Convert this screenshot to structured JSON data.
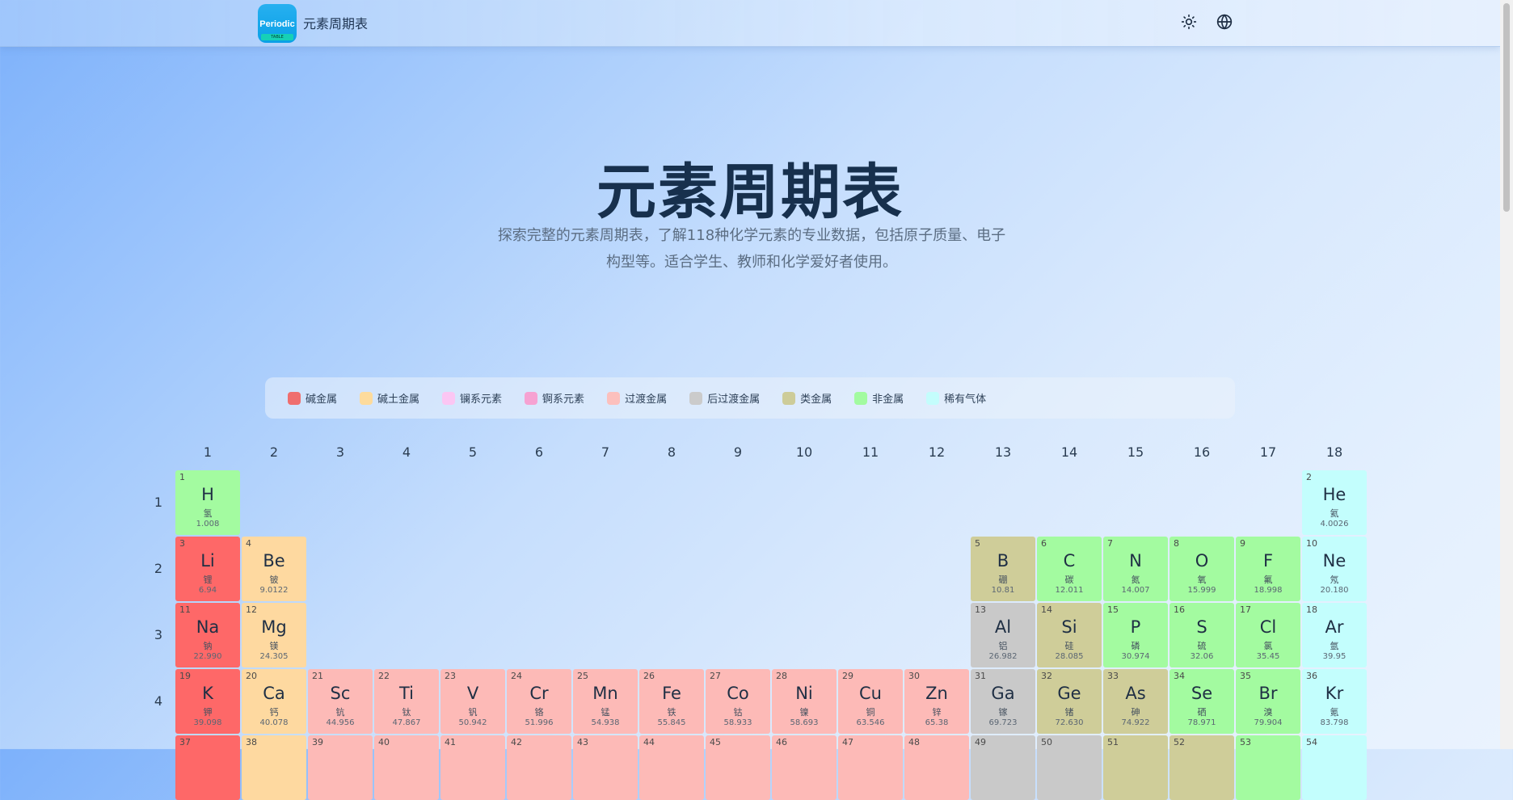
{
  "header": {
    "logo_text": "Periodic",
    "logo_sub": "TABLE",
    "title": "元素周期表",
    "icons": [
      "sun-icon",
      "globe-icon"
    ]
  },
  "hero": {
    "title": "元素周期表",
    "subtitle_line1": "探索完整的元素周期表，了解118种化学元素的专业数据，包括原子质量、电子",
    "subtitle_line2": "构型等。适合学生、教师和化学爱好者使用。"
  },
  "legend": [
    {
      "label": "碱金属",
      "color": "#ef6e6e"
    },
    {
      "label": "碱土金属",
      "color": "#fddb9c"
    },
    {
      "label": "镧系元素",
      "color": "#fbc6f3"
    },
    {
      "label": "锕系元素",
      "color": "#f6a2d2"
    },
    {
      "label": "过渡金属",
      "color": "#fcc0bd"
    },
    {
      "label": "后过渡金属",
      "color": "#cbcbcb"
    },
    {
      "label": "类金属",
      "color": "#cdcc99"
    },
    {
      "label": "非金属",
      "color": "#a2fba0"
    },
    {
      "label": "稀有气体",
      "color": "#c4fdfc"
    }
  ],
  "category_colors": {
    "alkali": "#fe6868",
    "alkaline": "#fed9a0",
    "transition": "#fdbab7",
    "post": "#c9c9c9",
    "metalloid": "#cfcd99",
    "nonmetal": "#a3fba0",
    "noble": "#c3fefd"
  },
  "groups": [
    "1",
    "2",
    "3",
    "4",
    "5",
    "6",
    "7",
    "8",
    "9",
    "10",
    "11",
    "12",
    "13",
    "14",
    "15",
    "16",
    "17",
    "18"
  ],
  "periods": [
    "1",
    "2",
    "3",
    "4"
  ],
  "elements": [
    {
      "n": "1",
      "s": "H",
      "cn": "氢",
      "m": "1.008",
      "g": 1,
      "p": 1,
      "c": "nonmetal"
    },
    {
      "n": "2",
      "s": "He",
      "cn": "氦",
      "m": "4.0026",
      "g": 18,
      "p": 1,
      "c": "noble"
    },
    {
      "n": "3",
      "s": "Li",
      "cn": "锂",
      "m": "6.94",
      "g": 1,
      "p": 2,
      "c": "alkali"
    },
    {
      "n": "4",
      "s": "Be",
      "cn": "铍",
      "m": "9.0122",
      "g": 2,
      "p": 2,
      "c": "alkaline"
    },
    {
      "n": "5",
      "s": "B",
      "cn": "硼",
      "m": "10.81",
      "g": 13,
      "p": 2,
      "c": "metalloid"
    },
    {
      "n": "6",
      "s": "C",
      "cn": "碳",
      "m": "12.011",
      "g": 14,
      "p": 2,
      "c": "nonmetal"
    },
    {
      "n": "7",
      "s": "N",
      "cn": "氮",
      "m": "14.007",
      "g": 15,
      "p": 2,
      "c": "nonmetal"
    },
    {
      "n": "8",
      "s": "O",
      "cn": "氧",
      "m": "15.999",
      "g": 16,
      "p": 2,
      "c": "nonmetal"
    },
    {
      "n": "9",
      "s": "F",
      "cn": "氟",
      "m": "18.998",
      "g": 17,
      "p": 2,
      "c": "nonmetal"
    },
    {
      "n": "10",
      "s": "Ne",
      "cn": "氖",
      "m": "20.180",
      "g": 18,
      "p": 2,
      "c": "noble"
    },
    {
      "n": "11",
      "s": "Na",
      "cn": "钠",
      "m": "22.990",
      "g": 1,
      "p": 3,
      "c": "alkali"
    },
    {
      "n": "12",
      "s": "Mg",
      "cn": "镁",
      "m": "24.305",
      "g": 2,
      "p": 3,
      "c": "alkaline"
    },
    {
      "n": "13",
      "s": "Al",
      "cn": "铝",
      "m": "26.982",
      "g": 13,
      "p": 3,
      "c": "post"
    },
    {
      "n": "14",
      "s": "Si",
      "cn": "硅",
      "m": "28.085",
      "g": 14,
      "p": 3,
      "c": "metalloid"
    },
    {
      "n": "15",
      "s": "P",
      "cn": "磷",
      "m": "30.974",
      "g": 15,
      "p": 3,
      "c": "nonmetal"
    },
    {
      "n": "16",
      "s": "S",
      "cn": "硫",
      "m": "32.06",
      "g": 16,
      "p": 3,
      "c": "nonmetal"
    },
    {
      "n": "17",
      "s": "Cl",
      "cn": "氯",
      "m": "35.45",
      "g": 17,
      "p": 3,
      "c": "nonmetal"
    },
    {
      "n": "18",
      "s": "Ar",
      "cn": "氩",
      "m": "39.95",
      "g": 18,
      "p": 3,
      "c": "noble"
    },
    {
      "n": "19",
      "s": "K",
      "cn": "钾",
      "m": "39.098",
      "g": 1,
      "p": 4,
      "c": "alkali"
    },
    {
      "n": "20",
      "s": "Ca",
      "cn": "钙",
      "m": "40.078",
      "g": 2,
      "p": 4,
      "c": "alkaline"
    },
    {
      "n": "21",
      "s": "Sc",
      "cn": "钪",
      "m": "44.956",
      "g": 3,
      "p": 4,
      "c": "transition"
    },
    {
      "n": "22",
      "s": "Ti",
      "cn": "钛",
      "m": "47.867",
      "g": 4,
      "p": 4,
      "c": "transition"
    },
    {
      "n": "23",
      "s": "V",
      "cn": "钒",
      "m": "50.942",
      "g": 5,
      "p": 4,
      "c": "transition"
    },
    {
      "n": "24",
      "s": "Cr",
      "cn": "铬",
      "m": "51.996",
      "g": 6,
      "p": 4,
      "c": "transition"
    },
    {
      "n": "25",
      "s": "Mn",
      "cn": "锰",
      "m": "54.938",
      "g": 7,
      "p": 4,
      "c": "transition"
    },
    {
      "n": "26",
      "s": "Fe",
      "cn": "铁",
      "m": "55.845",
      "g": 8,
      "p": 4,
      "c": "transition"
    },
    {
      "n": "27",
      "s": "Co",
      "cn": "钴",
      "m": "58.933",
      "g": 9,
      "p": 4,
      "c": "transition"
    },
    {
      "n": "28",
      "s": "Ni",
      "cn": "镍",
      "m": "58.693",
      "g": 10,
      "p": 4,
      "c": "transition"
    },
    {
      "n": "29",
      "s": "Cu",
      "cn": "铜",
      "m": "63.546",
      "g": 11,
      "p": 4,
      "c": "transition"
    },
    {
      "n": "30",
      "s": "Zn",
      "cn": "锌",
      "m": "65.38",
      "g": 12,
      "p": 4,
      "c": "transition"
    },
    {
      "n": "31",
      "s": "Ga",
      "cn": "镓",
      "m": "69.723",
      "g": 13,
      "p": 4,
      "c": "post"
    },
    {
      "n": "32",
      "s": "Ge",
      "cn": "锗",
      "m": "72.630",
      "g": 14,
      "p": 4,
      "c": "metalloid"
    },
    {
      "n": "33",
      "s": "As",
      "cn": "砷",
      "m": "74.922",
      "g": 15,
      "p": 4,
      "c": "metalloid"
    },
    {
      "n": "34",
      "s": "Se",
      "cn": "硒",
      "m": "78.971",
      "g": 16,
      "p": 4,
      "c": "nonmetal"
    },
    {
      "n": "35",
      "s": "Br",
      "cn": "溴",
      "m": "79.904",
      "g": 17,
      "p": 4,
      "c": "nonmetal"
    },
    {
      "n": "36",
      "s": "Kr",
      "cn": "氪",
      "m": "83.798",
      "g": 18,
      "p": 4,
      "c": "noble"
    },
    {
      "n": "37",
      "s": "",
      "cn": "",
      "m": "",
      "g": 1,
      "p": 5,
      "c": "alkali"
    },
    {
      "n": "38",
      "s": "",
      "cn": "",
      "m": "",
      "g": 2,
      "p": 5,
      "c": "alkaline"
    },
    {
      "n": "39",
      "s": "",
      "cn": "",
      "m": "",
      "g": 3,
      "p": 5,
      "c": "transition"
    },
    {
      "n": "40",
      "s": "",
      "cn": "",
      "m": "",
      "g": 4,
      "p": 5,
      "c": "transition"
    },
    {
      "n": "41",
      "s": "",
      "cn": "",
      "m": "",
      "g": 5,
      "p": 5,
      "c": "transition"
    },
    {
      "n": "42",
      "s": "",
      "cn": "",
      "m": "",
      "g": 6,
      "p": 5,
      "c": "transition"
    },
    {
      "n": "43",
      "s": "",
      "cn": "",
      "m": "",
      "g": 7,
      "p": 5,
      "c": "transition"
    },
    {
      "n": "44",
      "s": "",
      "cn": "",
      "m": "",
      "g": 8,
      "p": 5,
      "c": "transition"
    },
    {
      "n": "45",
      "s": "",
      "cn": "",
      "m": "",
      "g": 9,
      "p": 5,
      "c": "transition"
    },
    {
      "n": "46",
      "s": "",
      "cn": "",
      "m": "",
      "g": 10,
      "p": 5,
      "c": "transition"
    },
    {
      "n": "47",
      "s": "",
      "cn": "",
      "m": "",
      "g": 11,
      "p": 5,
      "c": "transition"
    },
    {
      "n": "48",
      "s": "",
      "cn": "",
      "m": "",
      "g": 12,
      "p": 5,
      "c": "transition"
    },
    {
      "n": "49",
      "s": "",
      "cn": "",
      "m": "",
      "g": 13,
      "p": 5,
      "c": "post"
    },
    {
      "n": "50",
      "s": "",
      "cn": "",
      "m": "",
      "g": 14,
      "p": 5,
      "c": "post"
    },
    {
      "n": "51",
      "s": "",
      "cn": "",
      "m": "",
      "g": 15,
      "p": 5,
      "c": "metalloid"
    },
    {
      "n": "52",
      "s": "",
      "cn": "",
      "m": "",
      "g": 16,
      "p": 5,
      "c": "metalloid"
    },
    {
      "n": "53",
      "s": "",
      "cn": "",
      "m": "",
      "g": 17,
      "p": 5,
      "c": "nonmetal"
    },
    {
      "n": "54",
      "s": "",
      "cn": "",
      "m": "",
      "g": 18,
      "p": 5,
      "c": "noble"
    }
  ]
}
